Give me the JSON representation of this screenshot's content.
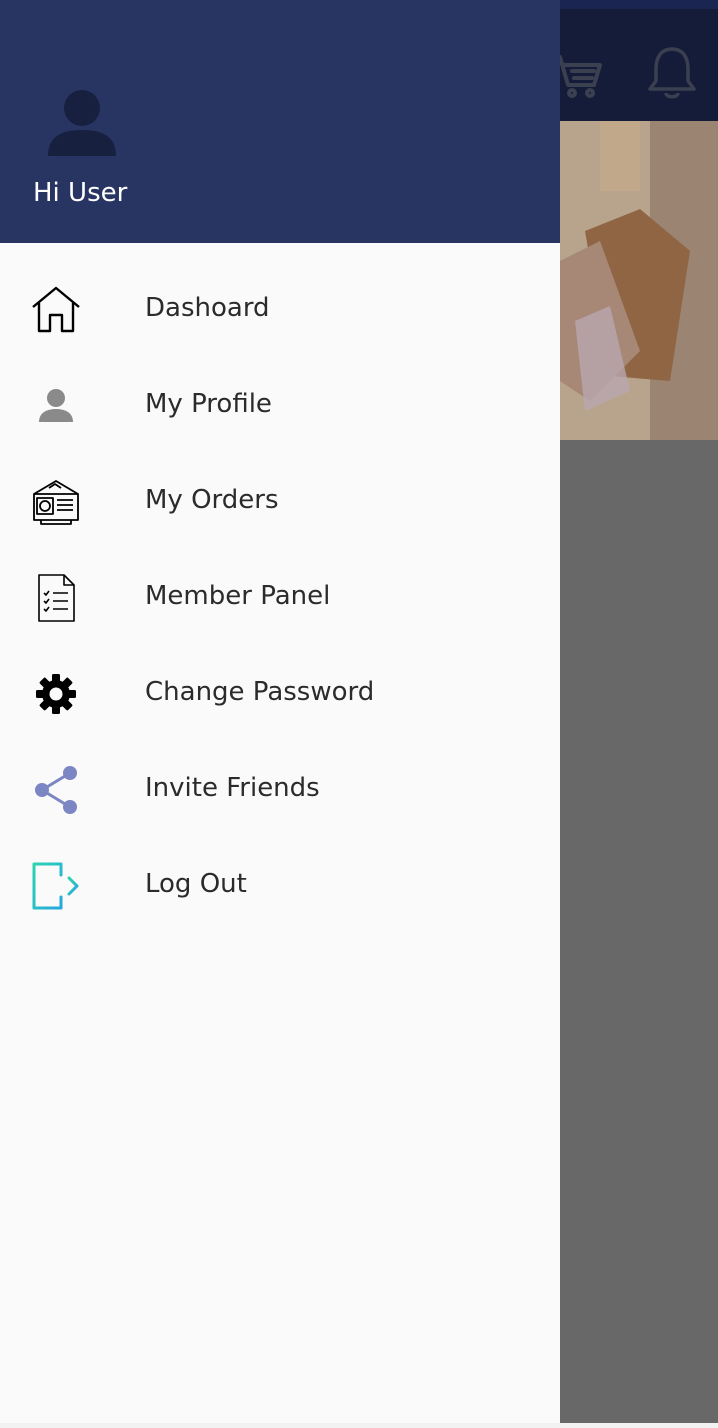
{
  "drawer": {
    "greeting": "Hi User",
    "header_color": "#283563",
    "items": [
      {
        "label": "Dashoard",
        "icon": "home-icon"
      },
      {
        "label": "My Profile",
        "icon": "person-icon"
      },
      {
        "label": "My Orders",
        "icon": "orders-icon"
      },
      {
        "label": "Member Panel",
        "icon": "checklist-document-icon"
      },
      {
        "label": "Change Password",
        "icon": "gear-icon"
      },
      {
        "label": "Invite Friends",
        "icon": "share-icon"
      },
      {
        "label": "Log Out",
        "icon": "logout-icon"
      }
    ]
  },
  "background_app": {
    "appbar_color": "#151c39",
    "icons": [
      "cart-icon",
      "bell-icon"
    ]
  }
}
